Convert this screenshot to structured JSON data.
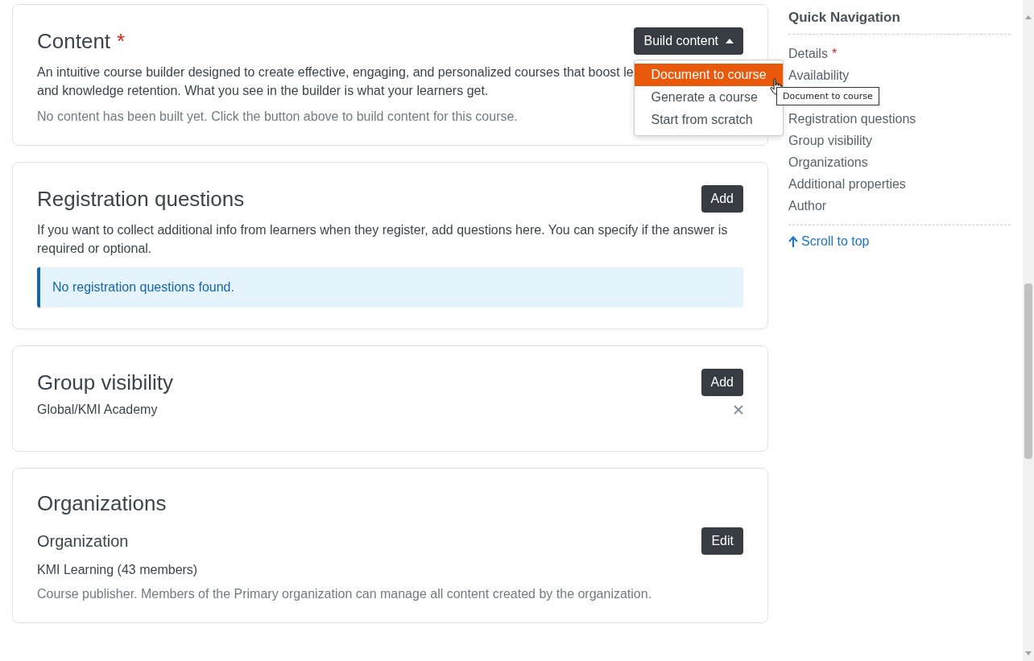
{
  "content": {
    "title": "Content",
    "required": true,
    "build_button": "Build content",
    "menu_open": true,
    "description_lines": [
      "An intuitive course builder designed to create effective, engaging, and personalized courses that boost le",
      "and knowledge retention. What you see in the builder is what your learners get."
    ],
    "note": "No content has been built yet. Click the button above to build content for this course.",
    "menu": [
      {
        "label": "Document to course",
        "selected": true
      },
      {
        "label": "Generate a course",
        "selected": false
      },
      {
        "label": "Start from scratch",
        "selected": false
      }
    ],
    "tooltip": "Document to course"
  },
  "registration": {
    "title": "Registration questions",
    "button": "Add",
    "description": "If you want to collect additional info from learners when they register, add questions here. You can specify if the answer is required or optional.",
    "alert": "No registration questions found."
  },
  "group_visibility": {
    "title": "Group visibility",
    "button": "Add",
    "groups": [
      "Global/KMI Academy"
    ]
  },
  "organizations": {
    "title": "Organizations",
    "subtitle": "Organization",
    "button": "Edit",
    "name": "KMI Learning (43 members)",
    "note": "Course publisher. Members of the Primary organization can manage all content created by the organization."
  },
  "quick_navigation": {
    "title": "Quick Navigation",
    "items": [
      {
        "label": "Details",
        "required": true
      },
      {
        "label": "Availability",
        "required": false
      },
      {
        "label": "Registration questions",
        "required": false
      },
      {
        "label": "Group visibility",
        "required": false
      },
      {
        "label": "Organizations",
        "required": false
      },
      {
        "label": "Additional properties",
        "required": false
      },
      {
        "label": "Author",
        "required": false
      }
    ],
    "scroll_top": "Scroll to top"
  },
  "required_mark": "*"
}
